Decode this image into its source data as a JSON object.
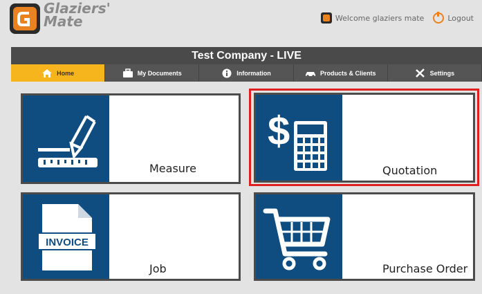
{
  "app": {
    "logo_line1": "Glaziers'",
    "logo_line2": "Mate",
    "welcome_text": "Welcome glaziers mate",
    "logout_label": "Logout"
  },
  "title_bar": {
    "text": "Test Company - LIVE"
  },
  "nav": {
    "items": [
      {
        "label": "Home",
        "icon": "home-icon"
      },
      {
        "label": "My Documents",
        "icon": "briefcase-icon"
      },
      {
        "label": "Information",
        "icon": "info-icon"
      },
      {
        "label": "Products & Clients",
        "icon": "car-icon"
      },
      {
        "label": "Settings",
        "icon": "tools-icon"
      }
    ],
    "active": "Home"
  },
  "tiles": [
    {
      "label": "Measure",
      "icon": "pencil-ruler-icon"
    },
    {
      "label": "Quotation",
      "icon": "dollar-calculator-icon"
    },
    {
      "label": "Job",
      "icon": "invoice-document-icon",
      "icon_text": "INVOICE"
    },
    {
      "label": "Purchase Order",
      "icon": "shopping-cart-icon"
    }
  ],
  "colors": {
    "accent": "#f7b51d",
    "tile_icon_bg": "#0f4c7f",
    "nav_bg": "#555555",
    "highlight": "#e02020"
  }
}
